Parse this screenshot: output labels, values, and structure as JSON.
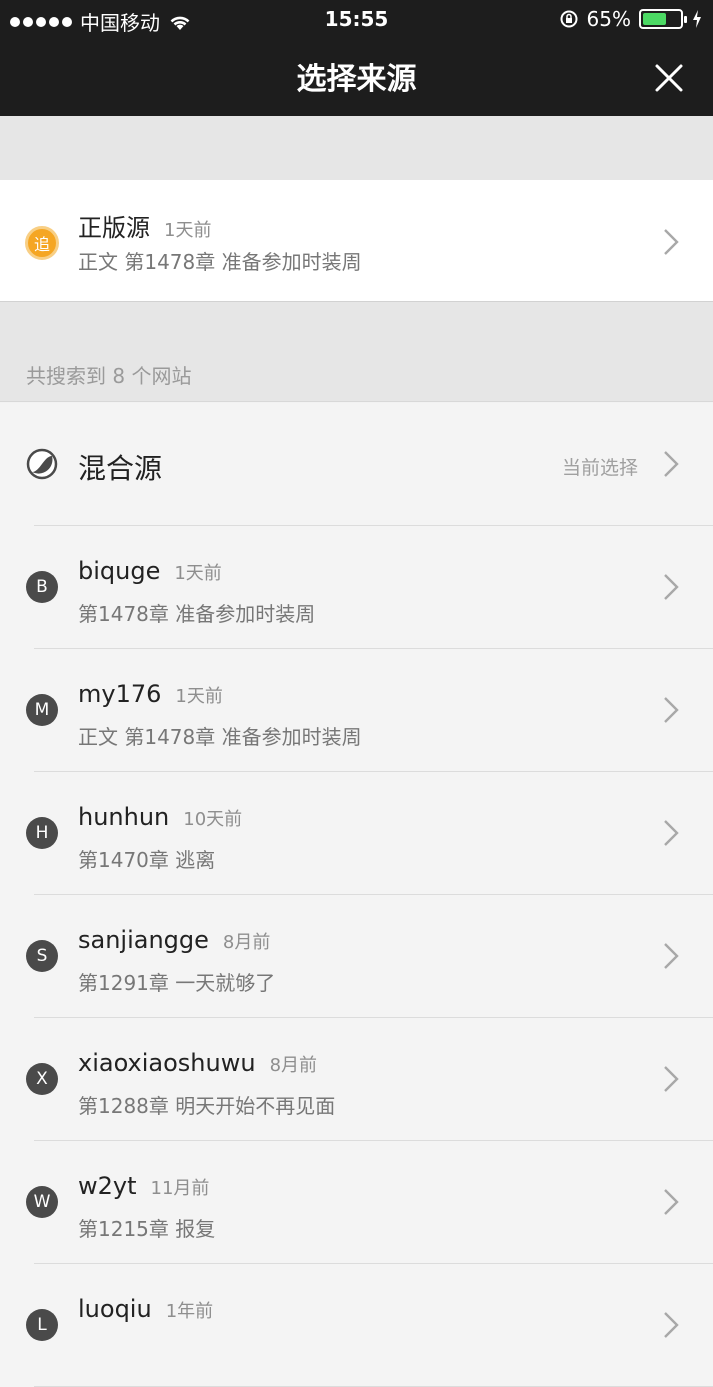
{
  "status_bar": {
    "carrier": "中国移动",
    "time": "15:55",
    "battery": "65%",
    "battery_level": 0.65
  },
  "nav": {
    "title": "选择来源",
    "close_icon": "close-icon"
  },
  "official": {
    "badge": "追",
    "name": "正版源",
    "time": "1天前",
    "chapter": "正文 第1478章 准备参加时装周"
  },
  "count_text": "共搜索到 8 个网站",
  "mixed": {
    "name": "混合源",
    "current_label": "当前选择"
  },
  "sources": [
    {
      "letter": "B",
      "name": "biquge",
      "time": "1天前",
      "chapter": "第1478章 准备参加时装周"
    },
    {
      "letter": "M",
      "name": "my176",
      "time": "1天前",
      "chapter": "正文 第1478章 准备参加时装周"
    },
    {
      "letter": "H",
      "name": "hunhun",
      "time": "10天前",
      "chapter": "第1470章 逃离"
    },
    {
      "letter": "S",
      "name": "sanjiangge",
      "time": "8月前",
      "chapter": "第1291章 一天就够了"
    },
    {
      "letter": "X",
      "name": "xiaoxiaoshuwu",
      "time": "8月前",
      "chapter": "第1288章 明天开始不再见面"
    },
    {
      "letter": "W",
      "name": "w2yt",
      "time": "11月前",
      "chapter": "第1215章 报复"
    },
    {
      "letter": "L",
      "name": "luoqiu",
      "time": "1年前",
      "chapter": ""
    }
  ]
}
